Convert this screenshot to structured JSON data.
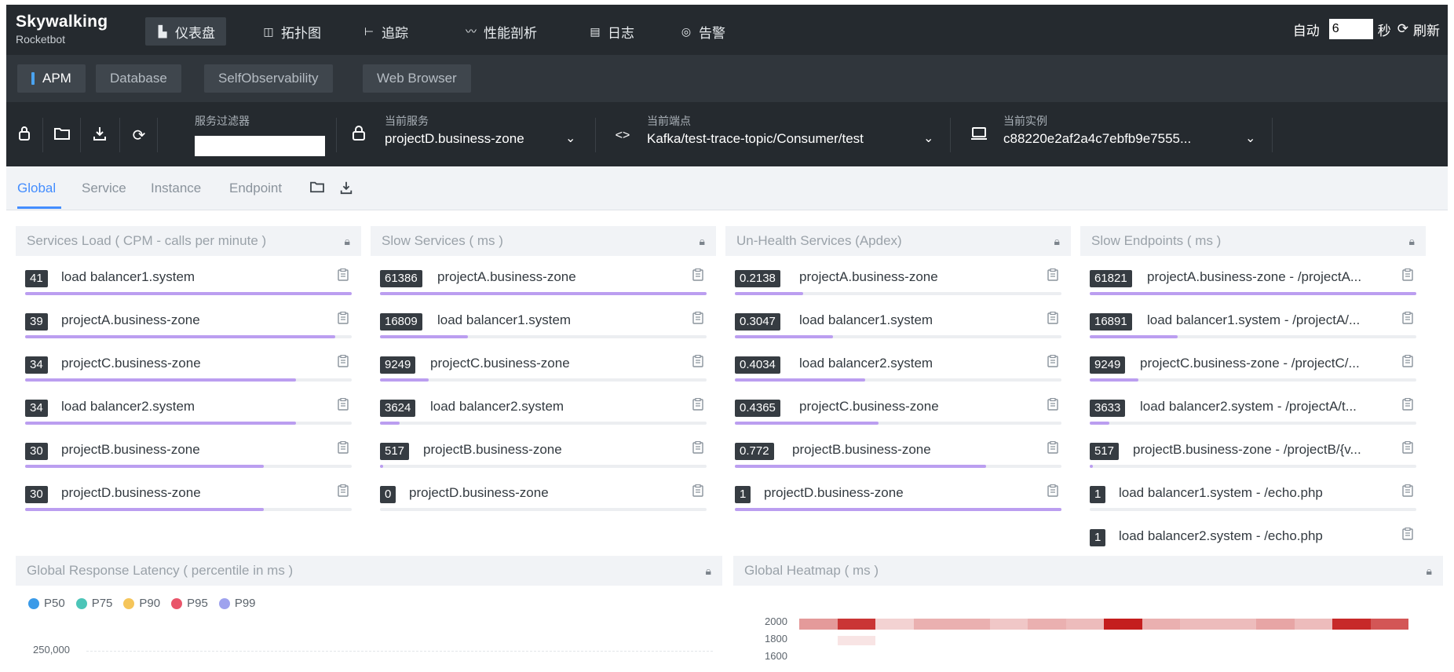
{
  "logo": {
    "line1": "Skywalking",
    "line2": "Rocketbot"
  },
  "nav": [
    {
      "label": "仪表盘",
      "icon": "dashboard-icon",
      "glyph": "▙",
      "active": true
    },
    {
      "label": "拓扑图",
      "icon": "topology-icon",
      "glyph": "◫",
      "active": false
    },
    {
      "label": "追踪",
      "icon": "trace-icon",
      "glyph": "⊢",
      "active": false
    },
    {
      "label": "性能剖析",
      "icon": "profile-icon",
      "glyph": "〰",
      "active": false
    },
    {
      "label": "日志",
      "icon": "log-icon",
      "glyph": "▤",
      "active": false
    },
    {
      "label": "告警",
      "icon": "alarm-icon",
      "glyph": "◎",
      "active": false
    }
  ],
  "auto_refresh": {
    "label": "自动",
    "interval": "6",
    "unit": "秒",
    "refresh_label": "刷新"
  },
  "layers": [
    {
      "label": "APM",
      "active": true
    },
    {
      "label": "Database",
      "active": false
    },
    {
      "label": "SelfObservability",
      "active": false
    },
    {
      "label": "Web Browser",
      "active": false
    }
  ],
  "toolbar": {
    "filter_label": "服务过滤器",
    "filter_value": "",
    "service": {
      "label": "当前服务",
      "value": "projectD.business-zone"
    },
    "endpoint": {
      "label": "当前端点",
      "value": "Kafka/test-trace-topic/Consumer/test"
    },
    "instance": {
      "label": "当前实例",
      "value": "c88220e2af2a4c7ebfb9e7555..."
    }
  },
  "dashboard_tabs": [
    {
      "label": "Global",
      "active": true
    },
    {
      "label": "Service",
      "active": false
    },
    {
      "label": "Instance",
      "active": false
    },
    {
      "label": "Endpoint",
      "active": false
    }
  ],
  "panels": [
    {
      "title": "Services Load ( CPM - calls per minute )",
      "rows": [
        {
          "value": "41",
          "name": "load balancer1.system",
          "ratio": 1.0
        },
        {
          "value": "39",
          "name": "projectA.business-zone",
          "ratio": 0.95
        },
        {
          "value": "34",
          "name": "projectC.business-zone",
          "ratio": 0.83
        },
        {
          "value": "34",
          "name": "load balancer2.system",
          "ratio": 0.83
        },
        {
          "value": "30",
          "name": "projectB.business-zone",
          "ratio": 0.73
        },
        {
          "value": "30",
          "name": "projectD.business-zone",
          "ratio": 0.73
        }
      ]
    },
    {
      "title": "Slow Services ( ms )",
      "rows": [
        {
          "value": "61386",
          "name": "projectA.business-zone",
          "ratio": 1.0
        },
        {
          "value": "16809",
          "name": "load balancer1.system",
          "ratio": 0.27
        },
        {
          "value": "9249",
          "name": "projectC.business-zone",
          "ratio": 0.15
        },
        {
          "value": "3624",
          "name": "load balancer2.system",
          "ratio": 0.06
        },
        {
          "value": "517",
          "name": "projectB.business-zone",
          "ratio": 0.01
        },
        {
          "value": "0",
          "name": "projectD.business-zone",
          "ratio": 0
        }
      ]
    },
    {
      "title": "Un-Health Services (Apdex)",
      "rows": [
        {
          "value": "0.2138",
          "name": "projectA.business-zone",
          "ratio": 0.21
        },
        {
          "value": "0.3047",
          "name": "load balancer1.system",
          "ratio": 0.3
        },
        {
          "value": "0.4034",
          "name": "load balancer2.system",
          "ratio": 0.4
        },
        {
          "value": "0.4365",
          "name": "projectC.business-zone",
          "ratio": 0.44
        },
        {
          "value": "0.772",
          "name": "projectB.business-zone",
          "ratio": 0.77
        },
        {
          "value": "1",
          "name": "projectD.business-zone",
          "ratio": 1.0
        }
      ]
    },
    {
      "title": "Slow Endpoints ( ms )",
      "rows": [
        {
          "value": "61821",
          "name": "projectA.business-zone - /projectA...",
          "ratio": 1.0
        },
        {
          "value": "16891",
          "name": "load balancer1.system - /projectA/...",
          "ratio": 0.27
        },
        {
          "value": "9249",
          "name": "projectC.business-zone - /projectC/...",
          "ratio": 0.15
        },
        {
          "value": "3633",
          "name": "load balancer2.system - /projectA/t...",
          "ratio": 0.06
        },
        {
          "value": "517",
          "name": "projectB.business-zone - /projectB/{v...",
          "ratio": 0.01
        },
        {
          "value": "1",
          "name": "load balancer1.system - /echo.php",
          "ratio": 0
        },
        {
          "value": "1",
          "name": "load balancer2.system - /echo.php",
          "ratio": 0
        }
      ]
    }
  ],
  "latency": {
    "title": "Global Response Latency ( percentile in ms )",
    "legend": [
      {
        "name": "P50",
        "color": "#3a9ae8"
      },
      {
        "name": "P75",
        "color": "#4cc5b8"
      },
      {
        "name": "P90",
        "color": "#f5c55a"
      },
      {
        "name": "P95",
        "color": "#e9556a"
      },
      {
        "name": "P99",
        "color": "#9ea2ee"
      }
    ],
    "y_tick": "250,000"
  },
  "heatmap": {
    "title": "Global Heatmap ( ms )",
    "y_ticks": [
      "2000",
      "1800",
      "1600"
    ],
    "row_2000": [
      0.45,
      0.9,
      0.2,
      0.35,
      0.35,
      0.25,
      0.35,
      0.3,
      1.0,
      0.35,
      0.3,
      0.3,
      0.4,
      0.3,
      0.95,
      0.75
    ],
    "row_1800": [
      0,
      0.12,
      0,
      0,
      0,
      0,
      0,
      0,
      0,
      0,
      0,
      0,
      0,
      0,
      0,
      0
    ]
  }
}
